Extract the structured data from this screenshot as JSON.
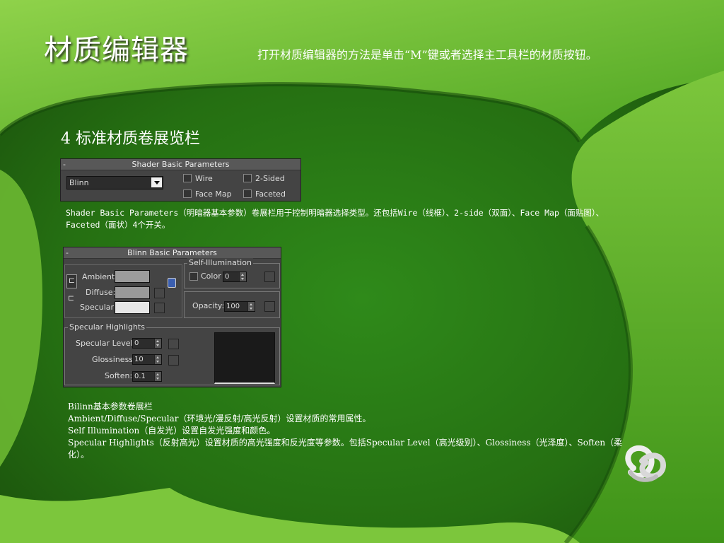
{
  "slide": {
    "title": "材质编辑器",
    "subtitle": "打开材质编辑器的方法是单击“M”键或者选择主工具栏的材质按钮。",
    "section_heading": "4 标准材质卷展览栏",
    "shader_description": "Shader Basic Parameters（明暗器基本参数）卷展栏用于控制明暗器选择类型。还包括Wire（线框）、2-side（双面）、Face Map（面贴图）、 Faceted（面状）4个开关。",
    "blinn_description_lines": [
      "Bilinn基本参数卷展栏",
      "Ambient/Diffuse/Specular（环境光/漫反射/高光反射）设置材质的常用属性。",
      "Self Illumination（自发光）设置自发光强度和颜色。",
      "Specular Highlights（反射高光）设置材质的高光强度和反光度等参数。包括Specular Level（高光级别）、Glossiness（光泽度）、Soften（柔化）。"
    ]
  },
  "shader_panel": {
    "header": "Shader Basic Parameters",
    "collapse": "-",
    "shader_value": "Blinn",
    "wire_label": "Wire",
    "two_sided_label": "2-Sided",
    "face_map_label": "Face Map",
    "faceted_label": "Faceted"
  },
  "blinn_panel": {
    "header": "Blinn Basic Parameters",
    "collapse": "-",
    "ambient_label": "Ambient:",
    "diffuse_label": "Diffuse:",
    "specular_label": "Specular:",
    "self_illum_group": "Self-Illumination",
    "color_label": "Color",
    "color_value": "0",
    "opacity_label": "Opacity:",
    "opacity_value": "100",
    "spec_highlights_group": "Specular Highlights",
    "spec_level_label": "Specular Level:",
    "spec_level_value": "0",
    "glossiness_label": "Glossiness:",
    "glossiness_value": "10",
    "soften_label": "Soften:",
    "soften_value": "0.1",
    "colors": {
      "ambient": "#9c9c9c",
      "diffuse": "#9a9a9a",
      "specular": "#e6e6e6"
    }
  }
}
